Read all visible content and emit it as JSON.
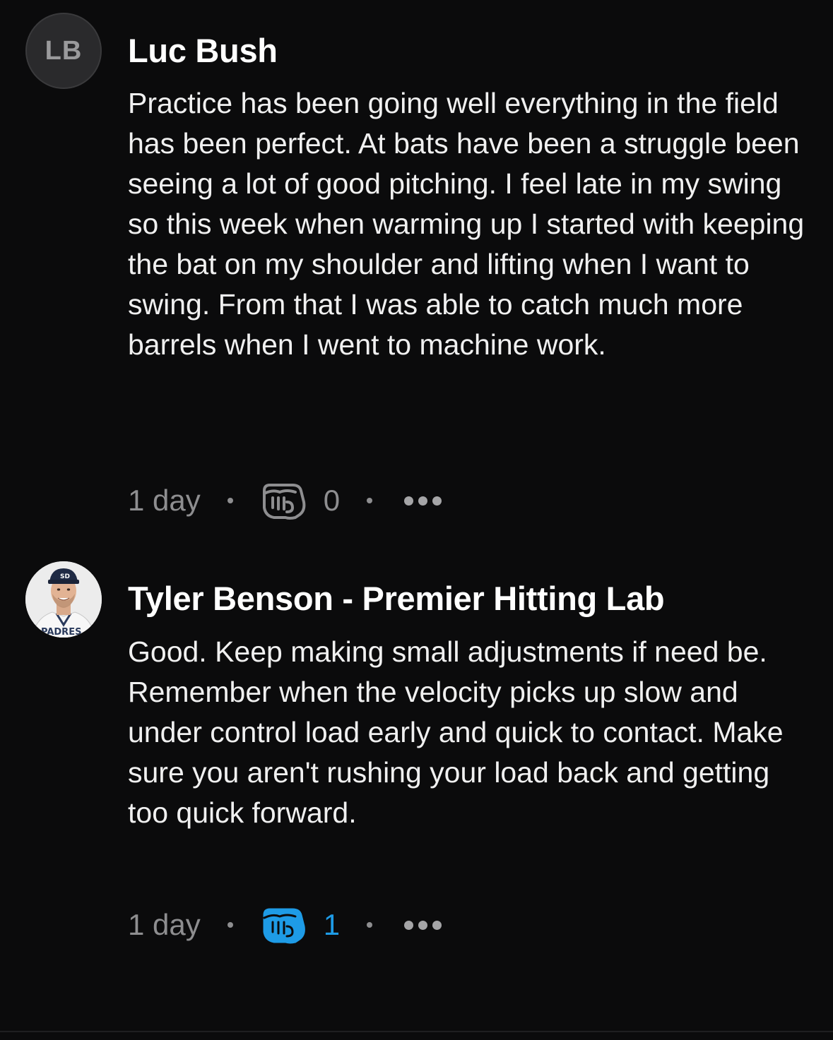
{
  "comments": [
    {
      "author": "Luc Bush",
      "avatar_initials": "LB",
      "text": "Practice has been going well everything in the field has been perfect. At bats have been a struggle been seeing a lot of good pitching. I feel late in my swing so this week when warming up I started with keeping the bat on my shoulder and lifting when I want to swing. From that I was able to catch much more barrels when I went to machine work.",
      "time": "1 day",
      "reaction_icon": "fist-bump-icon",
      "reaction_count": "0",
      "reacted": false,
      "more_icon": "more-options-icon"
    },
    {
      "author": "Tyler Benson - Premier Hitting Lab",
      "avatar": "profile-photo",
      "text": "Good. Keep making small adjustments if need be. Remember when the velocity picks up slow and under control load early and quick to contact. Make sure you aren't rushing your load back and getting too quick forward.",
      "time": "1 day",
      "reaction_icon": "fist-bump-icon",
      "reaction_count": "1",
      "reacted": true,
      "more_icon": "more-options-icon"
    }
  ],
  "colors": {
    "background": "#0b0b0c",
    "text": "#f0f0f0",
    "muted": "#8e8e90",
    "accent": "#1e9be6"
  }
}
